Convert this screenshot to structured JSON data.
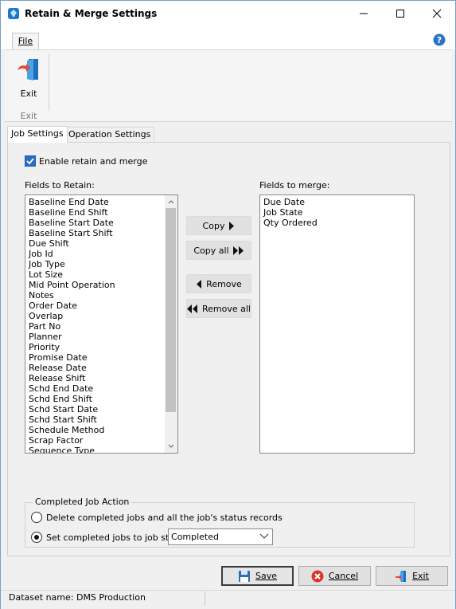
{
  "window": {
    "title": "Retain & Merge Settings"
  },
  "ribbon": {
    "file_tab": "File",
    "exit_label": "Exit",
    "group_label": "Exit"
  },
  "tabs": [
    "Job Settings",
    "Operation Settings"
  ],
  "enable": {
    "label": "Enable retain and merge",
    "checked": true
  },
  "retain": {
    "label": "Fields to Retain:",
    "items": [
      "Baseline End Date",
      "Baseline End Shift",
      "Baseline Start Date",
      "Baseline Start Shift",
      "Due Shift",
      "Job Id",
      "Job Type",
      "Lot Size",
      "Mid Point Operation",
      "Notes",
      "Order Date",
      "Overlap",
      "Part No",
      "Planner",
      "Priority",
      "Promise Date",
      "Release Date",
      "Release Shift",
      "Schd End Date",
      "Schd End Shift",
      "Schd Start Date",
      "Schd Start Shift",
      "Schedule Method",
      "Scrap Factor",
      "Sequence Type"
    ]
  },
  "merge": {
    "label": "Fields to merge:",
    "items": [
      "Due Date",
      "Job State",
      "Qty Ordered"
    ]
  },
  "buttons": {
    "copy": "Copy",
    "copy_all": "Copy all",
    "remove": "Remove",
    "remove_all": "Remove all"
  },
  "completed": {
    "title": "Completed Job Action",
    "option_delete": "Delete completed jobs and all the job's status records",
    "option_set": "Set completed jobs to job state",
    "selected_option": "set",
    "state_value": "Completed"
  },
  "footer": {
    "save": "Save",
    "cancel": "Cancel",
    "exit": "Exit"
  },
  "status": {
    "text": "Dataset name:  DMS Production"
  },
  "colors": {
    "accent": "#2d6cc0",
    "titlebar": "#ffffff",
    "window_bg": "#f0f0f0"
  }
}
